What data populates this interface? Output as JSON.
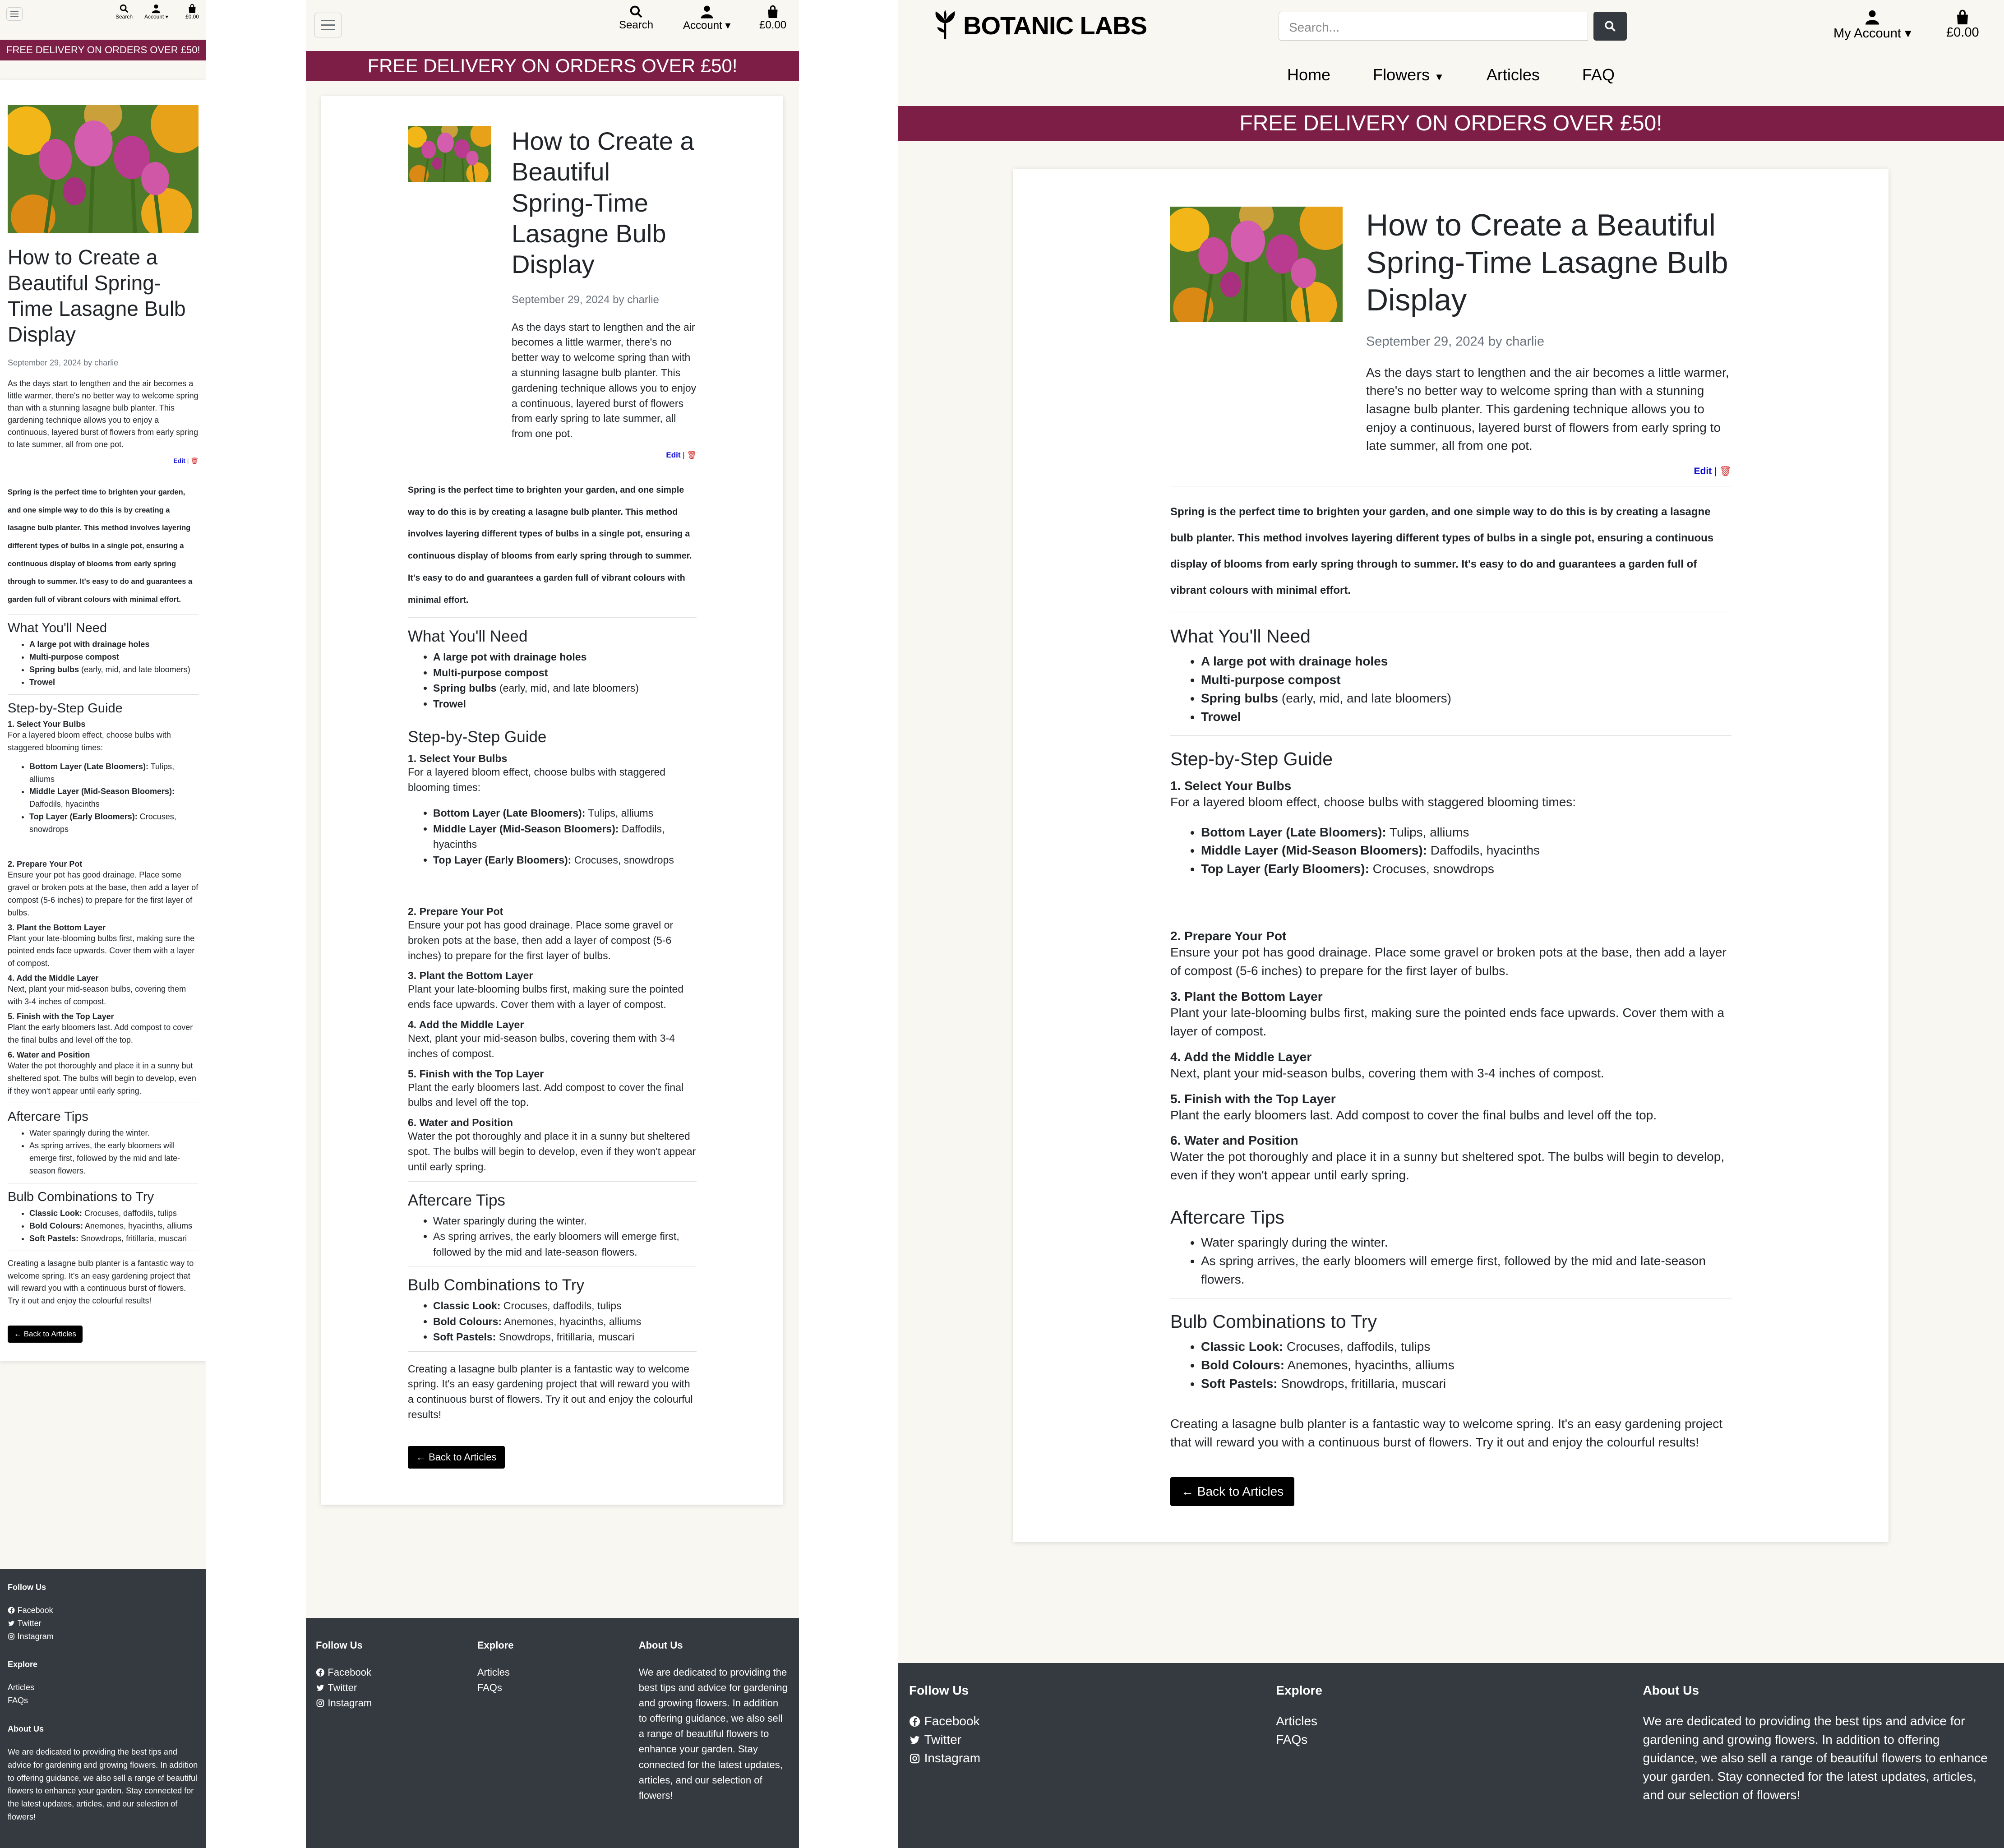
{
  "site": {
    "brand": "BOTANIC LABS",
    "search_placeholder": "Search...",
    "search_label": "Search",
    "account_label": "Account",
    "my_account_label": "My Account",
    "cart_total": "£0.00",
    "nav": [
      "Home",
      "Flowers",
      "Articles",
      "FAQ"
    ],
    "banner": "FREE DELIVERY ON ORDERS OVER £50!",
    "colors": {
      "banner": "#7c1e45",
      "footer": "#343a40",
      "page_bg": "#f8f7f2"
    }
  },
  "article": {
    "title": "How to Create a Beautiful Spring-Time Lasagne Bulb Display",
    "date": "September 29, 2024",
    "by": "by",
    "author": "charlie",
    "intro": "As the days start to lengthen and the air becomes a little warmer, there's no better way to welcome spring than with a stunning lasagne bulb planter. This gardening technique allows you to enjoy a continuous, layered burst of flowers from early spring to late summer, all from one pot.",
    "edit": "Edit",
    "separator": "|",
    "body": "Spring is the perfect time to brighten your garden, and one simple way to do this is by creating a lasagne bulb planter. This method involves layering different types of bulbs in a single pot, ensuring a continuous display of blooms from early spring through to summer. It's easy to do and guarantees a garden full of vibrant colours with minimal effort.",
    "need_heading": "What You'll Need",
    "need_items": [
      {
        "b": "A large pot with drainage holes",
        "t": ""
      },
      {
        "b": "Multi-purpose compost",
        "t": ""
      },
      {
        "b": "Spring bulbs",
        "t": " (early, mid, and late bloomers)"
      },
      {
        "b": "Trowel",
        "t": ""
      }
    ],
    "guide_heading": "Step-by-Step Guide",
    "step1_title": "1. Select Your Bulbs",
    "step1_text": "For a layered bloom effect, choose bulbs with staggered blooming times:",
    "layers": [
      {
        "b": "Bottom Layer (Late Bloomers):",
        "t": " Tulips, alliums"
      },
      {
        "b": "Middle Layer (Mid-Season Bloomers):",
        "t": " Daffodils, hyacinths"
      },
      {
        "b": "Top Layer (Early Bloomers):",
        "t": " Crocuses, snowdrops"
      }
    ],
    "steps": [
      {
        "title": "2. Prepare Your Pot",
        "text": "Ensure your pot has good drainage. Place some gravel or broken pots at the base, then add a layer of compost (5-6 inches) to prepare for the first layer of bulbs."
      },
      {
        "title": "3. Plant the Bottom Layer",
        "text": "Plant your late-blooming bulbs first, making sure the pointed ends face upwards. Cover them with a layer of compost."
      },
      {
        "title": "4. Add the Middle Layer",
        "text": "Next, plant your mid-season bulbs, covering them with 3-4 inches of compost."
      },
      {
        "title": "5. Finish with the Top Layer",
        "text": "Plant the early bloomers last. Add compost to cover the final bulbs and level off the top."
      },
      {
        "title": "6. Water and Position",
        "text": "Water the pot thoroughly and place it in a sunny but sheltered spot. The bulbs will begin to develop, even if they won't appear until early spring."
      }
    ],
    "aftercare_heading": "Aftercare Tips",
    "aftercare": [
      "Water sparingly during the winter.",
      "As spring arrives, the early bloomers will emerge first, followed by the mid and late-season flowers."
    ],
    "combos_heading": "Bulb Combinations to Try",
    "combos": [
      {
        "b": "Classic Look:",
        "t": " Crocuses, daffodils, tulips"
      },
      {
        "b": "Bold Colours:",
        "t": " Anemones, hyacinths, alliums"
      },
      {
        "b": "Soft Pastels:",
        "t": " Snowdrops, fritillaria, muscari"
      }
    ],
    "closing": "Creating a lasagne bulb planter is a fantastic way to welcome spring. It's an easy gardening project that will reward you with a continuous burst of flowers. Try it out and enjoy the colourful results!",
    "back_button": "← Back to Articles"
  },
  "footer": {
    "follow_heading": "Follow Us",
    "follow_links": [
      "Facebook",
      "Twitter",
      "Instagram"
    ],
    "explore_heading": "Explore",
    "explore_links": [
      "Articles",
      "FAQs"
    ],
    "about_heading": "About Us",
    "about_text": "We are dedicated to providing the best tips and advice for gardening and growing flowers. In addition to offering guidance, we also sell a range of beautiful flowers to enhance your garden. Stay connected for the latest updates, articles, and our selection of flowers!"
  }
}
